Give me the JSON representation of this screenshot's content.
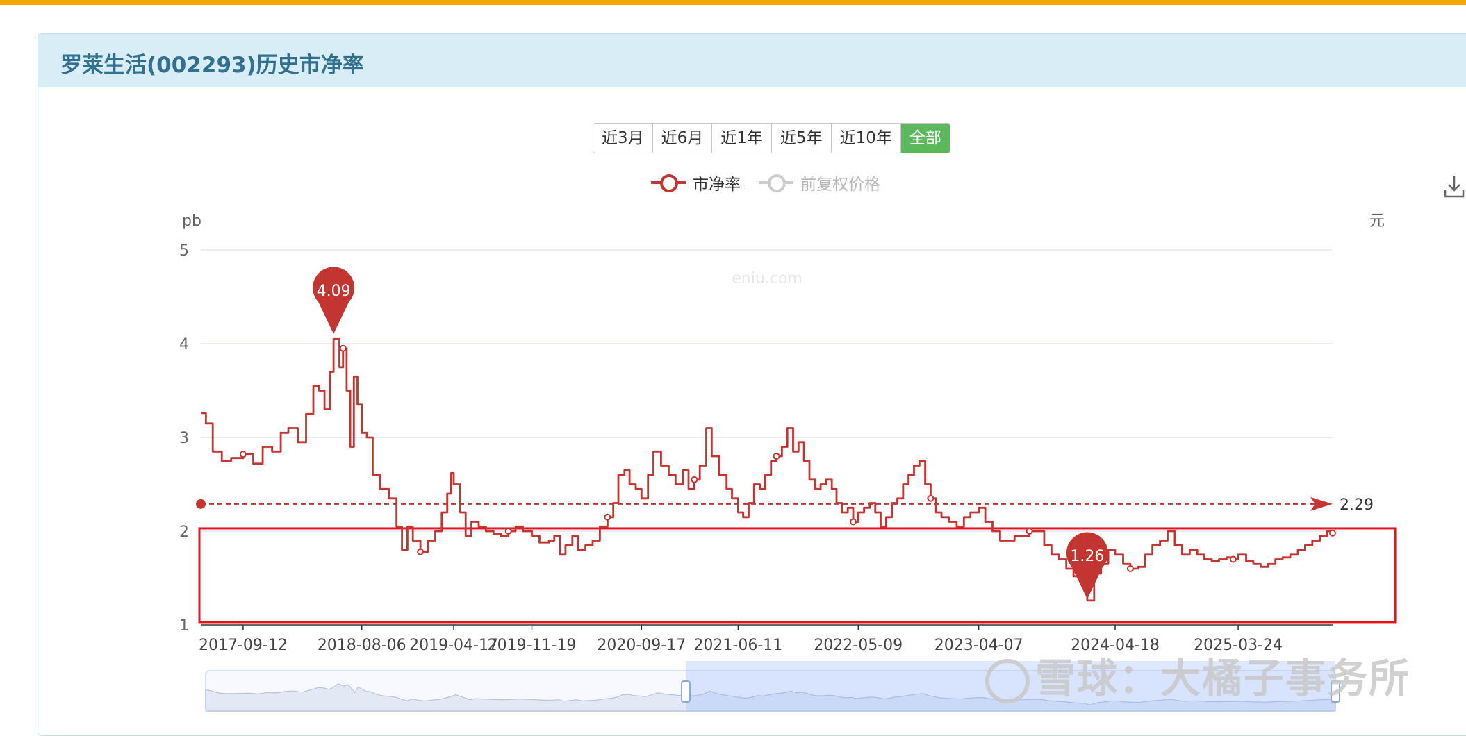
{
  "page": {
    "title": "罗莱生活(002293)历史市净率"
  },
  "range_buttons": [
    {
      "label": "近3月"
    },
    {
      "label": "近6月"
    },
    {
      "label": "近1年"
    },
    {
      "label": "近5年"
    },
    {
      "label": "近10年"
    },
    {
      "label": "全部",
      "active": true
    }
  ],
  "legend": [
    {
      "label": "市净率",
      "color": "#c23531",
      "active": true
    },
    {
      "label": "前复权价格",
      "color": "#cccccc",
      "active": false
    }
  ],
  "watermark_site": "eniu.com",
  "watermark_brand": "雪球：大橘子事务所",
  "download_icon": "download-icon",
  "colors": {
    "accent": "#f5a400",
    "series": "#c23531",
    "header_bg": "#d9edf7",
    "title": "#31708f",
    "active_button": "#5cb85c",
    "highlight_box": "#e8141c"
  },
  "chart_data": {
    "type": "line",
    "left_axis_label": "pb",
    "right_axis_label": "元",
    "ylim": [
      1,
      5
    ],
    "yticks": [
      "1",
      "2",
      "3",
      "4",
      "5"
    ],
    "xlim": [
      "2017-05-18",
      "2025-12-10"
    ],
    "xtick_labels": [
      "2017-09-12",
      "2018-08-06",
      "2019-04-17",
      "2019-11-19",
      "2020-09-17",
      "2021-06-11",
      "2022-05-09",
      "2023-04-07",
      "2024-04-18",
      "2025-03-24"
    ],
    "grid": true,
    "series": [
      {
        "name": "市净率",
        "points": [
          [
            "2017-05-18",
            3.26
          ],
          [
            "2017-06-01",
            3.15
          ],
          [
            "2017-06-20",
            2.85
          ],
          [
            "2017-07-15",
            2.75
          ],
          [
            "2017-08-10",
            2.78
          ],
          [
            "2017-09-12",
            2.82
          ],
          [
            "2017-10-10",
            2.72
          ],
          [
            "2017-11-05",
            2.9
          ],
          [
            "2017-12-01",
            2.85
          ],
          [
            "2017-12-25",
            3.05
          ],
          [
            "2018-01-15",
            3.1
          ],
          [
            "2018-02-10",
            2.95
          ],
          [
            "2018-03-05",
            3.25
          ],
          [
            "2018-03-25",
            3.55
          ],
          [
            "2018-04-10",
            3.5
          ],
          [
            "2018-04-25",
            3.3
          ],
          [
            "2018-05-10",
            3.7
          ],
          [
            "2018-05-20",
            4.05
          ],
          [
            "2018-06-05",
            3.75
          ],
          [
            "2018-06-15",
            3.95
          ],
          [
            "2018-06-25",
            3.5
          ],
          [
            "2018-07-05",
            2.9
          ],
          [
            "2018-07-15",
            3.65
          ],
          [
            "2018-07-25",
            3.35
          ],
          [
            "2018-08-06",
            3.05
          ],
          [
            "2018-08-20",
            3.0
          ],
          [
            "2018-09-05",
            2.6
          ],
          [
            "2018-09-25",
            2.45
          ],
          [
            "2018-10-20",
            2.35
          ],
          [
            "2018-11-10",
            2.05
          ],
          [
            "2018-11-25",
            1.8
          ],
          [
            "2018-12-10",
            2.05
          ],
          [
            "2018-12-25",
            1.9
          ],
          [
            "2019-01-15",
            1.78
          ],
          [
            "2019-02-05",
            1.9
          ],
          [
            "2019-02-25",
            2.0
          ],
          [
            "2019-03-15",
            2.2
          ],
          [
            "2019-03-30",
            2.4
          ],
          [
            "2019-04-10",
            2.62
          ],
          [
            "2019-04-17",
            2.5
          ],
          [
            "2019-05-05",
            2.2
          ],
          [
            "2019-05-20",
            1.95
          ],
          [
            "2019-06-05",
            2.1
          ],
          [
            "2019-06-25",
            2.05
          ],
          [
            "2019-07-15",
            2.0
          ],
          [
            "2019-08-05",
            1.97
          ],
          [
            "2019-08-25",
            1.95
          ],
          [
            "2019-09-15",
            2.0
          ],
          [
            "2019-10-05",
            2.05
          ],
          [
            "2019-10-25",
            2.0
          ],
          [
            "2019-11-19",
            1.95
          ],
          [
            "2019-12-10",
            1.88
          ],
          [
            "2020-01-05",
            1.9
          ],
          [
            "2020-01-20",
            1.95
          ],
          [
            "2020-02-05",
            1.75
          ],
          [
            "2020-02-20",
            1.85
          ],
          [
            "2020-03-10",
            1.95
          ],
          [
            "2020-03-25",
            1.8
          ],
          [
            "2020-04-15",
            1.85
          ],
          [
            "2020-05-05",
            1.9
          ],
          [
            "2020-05-25",
            2.05
          ],
          [
            "2020-06-15",
            2.15
          ],
          [
            "2020-07-01",
            2.3
          ],
          [
            "2020-07-15",
            2.6
          ],
          [
            "2020-08-01",
            2.65
          ],
          [
            "2020-08-15",
            2.5
          ],
          [
            "2020-09-01",
            2.45
          ],
          [
            "2020-09-17",
            2.35
          ],
          [
            "2020-10-05",
            2.6
          ],
          [
            "2020-10-20",
            2.85
          ],
          [
            "2020-11-10",
            2.7
          ],
          [
            "2020-12-01",
            2.6
          ],
          [
            "2020-12-20",
            2.5
          ],
          [
            "2021-01-10",
            2.65
          ],
          [
            "2021-01-25",
            2.45
          ],
          [
            "2021-02-10",
            2.55
          ],
          [
            "2021-02-25",
            2.7
          ],
          [
            "2021-03-15",
            3.1
          ],
          [
            "2021-03-30",
            2.8
          ],
          [
            "2021-04-20",
            2.6
          ],
          [
            "2021-05-10",
            2.45
          ],
          [
            "2021-05-25",
            2.35
          ],
          [
            "2021-06-11",
            2.2
          ],
          [
            "2021-06-25",
            2.15
          ],
          [
            "2021-07-10",
            2.3
          ],
          [
            "2021-07-25",
            2.5
          ],
          [
            "2021-08-10",
            2.45
          ],
          [
            "2021-08-25",
            2.6
          ],
          [
            "2021-09-10",
            2.75
          ],
          [
            "2021-09-25",
            2.8
          ],
          [
            "2021-10-10",
            2.9
          ],
          [
            "2021-10-25",
            3.1
          ],
          [
            "2021-11-10",
            2.85
          ],
          [
            "2021-11-25",
            2.95
          ],
          [
            "2021-12-10",
            2.75
          ],
          [
            "2021-12-25",
            2.55
          ],
          [
            "2022-01-10",
            2.45
          ],
          [
            "2022-01-25",
            2.5
          ],
          [
            "2022-02-10",
            2.55
          ],
          [
            "2022-02-25",
            2.45
          ],
          [
            "2022-03-10",
            2.3
          ],
          [
            "2022-03-25",
            2.2
          ],
          [
            "2022-04-10",
            2.25
          ],
          [
            "2022-04-25",
            2.1
          ],
          [
            "2022-05-09",
            2.2
          ],
          [
            "2022-05-25",
            2.25
          ],
          [
            "2022-06-10",
            2.3
          ],
          [
            "2022-06-25",
            2.2
          ],
          [
            "2022-07-10",
            2.05
          ],
          [
            "2022-07-25",
            2.15
          ],
          [
            "2022-08-10",
            2.3
          ],
          [
            "2022-08-25",
            2.35
          ],
          [
            "2022-09-10",
            2.5
          ],
          [
            "2022-09-25",
            2.6
          ],
          [
            "2022-10-10",
            2.7
          ],
          [
            "2022-10-25",
            2.75
          ],
          [
            "2022-11-10",
            2.5
          ],
          [
            "2022-11-25",
            2.35
          ],
          [
            "2022-12-10",
            2.2
          ],
          [
            "2022-12-25",
            2.15
          ],
          [
            "2023-01-15",
            2.1
          ],
          [
            "2023-02-05",
            2.05
          ],
          [
            "2023-02-25",
            2.15
          ],
          [
            "2023-03-15",
            2.2
          ],
          [
            "2023-04-07",
            2.25
          ],
          [
            "2023-04-25",
            2.1
          ],
          [
            "2023-05-15",
            2.0
          ],
          [
            "2023-06-05",
            1.9
          ],
          [
            "2023-06-25",
            1.9
          ],
          [
            "2023-07-15",
            1.95
          ],
          [
            "2023-08-05",
            1.95
          ],
          [
            "2023-08-25",
            2.0
          ],
          [
            "2023-09-15",
            2.0
          ],
          [
            "2023-10-05",
            1.85
          ],
          [
            "2023-10-25",
            1.75
          ],
          [
            "2023-11-15",
            1.7
          ],
          [
            "2023-12-05",
            1.6
          ],
          [
            "2023-12-25",
            1.52
          ],
          [
            "2024-01-15",
            1.45
          ],
          [
            "2024-02-01",
            1.26
          ],
          [
            "2024-02-20",
            1.55
          ],
          [
            "2024-03-10",
            1.65
          ],
          [
            "2024-03-30",
            1.8
          ],
          [
            "2024-04-18",
            1.75
          ],
          [
            "2024-05-10",
            1.65
          ],
          [
            "2024-05-30",
            1.6
          ],
          [
            "2024-06-20",
            1.62
          ],
          [
            "2024-07-10",
            1.75
          ],
          [
            "2024-07-30",
            1.85
          ],
          [
            "2024-08-20",
            1.9
          ],
          [
            "2024-09-10",
            2.0
          ],
          [
            "2024-09-30",
            1.85
          ],
          [
            "2024-10-20",
            1.75
          ],
          [
            "2024-11-10",
            1.8
          ],
          [
            "2024-12-01",
            1.75
          ],
          [
            "2024-12-20",
            1.7
          ],
          [
            "2025-01-10",
            1.68
          ],
          [
            "2025-01-30",
            1.7
          ],
          [
            "2025-02-20",
            1.72
          ],
          [
            "2025-03-10",
            1.7
          ],
          [
            "2025-03-24",
            1.75
          ],
          [
            "2025-04-15",
            1.68
          ],
          [
            "2025-05-05",
            1.65
          ],
          [
            "2025-05-25",
            1.62
          ],
          [
            "2025-06-15",
            1.65
          ],
          [
            "2025-07-05",
            1.7
          ],
          [
            "2025-07-25",
            1.72
          ],
          [
            "2025-08-15",
            1.75
          ],
          [
            "2025-09-05",
            1.8
          ],
          [
            "2025-09-25",
            1.85
          ],
          [
            "2025-10-15",
            1.9
          ],
          [
            "2025-11-05",
            1.95
          ],
          [
            "2025-11-25",
            2.0
          ],
          [
            "2025-12-10",
            1.98
          ]
        ]
      }
    ],
    "max_marker": {
      "date": "2018-05-20",
      "value": 4.09,
      "label": "4.09"
    },
    "min_marker": {
      "date": "2024-02-01",
      "value": 1.26,
      "label": "1.26"
    },
    "average_line": {
      "value": 2.29,
      "label": "2.29"
    },
    "highlight_box": {
      "y_from": 1.03,
      "y_to": 2.03,
      "x_from": "2017-05-18",
      "x_to": "2026-06-01"
    },
    "data_zoom": {
      "start_fraction": 0.425,
      "end_fraction": 1.0
    }
  }
}
